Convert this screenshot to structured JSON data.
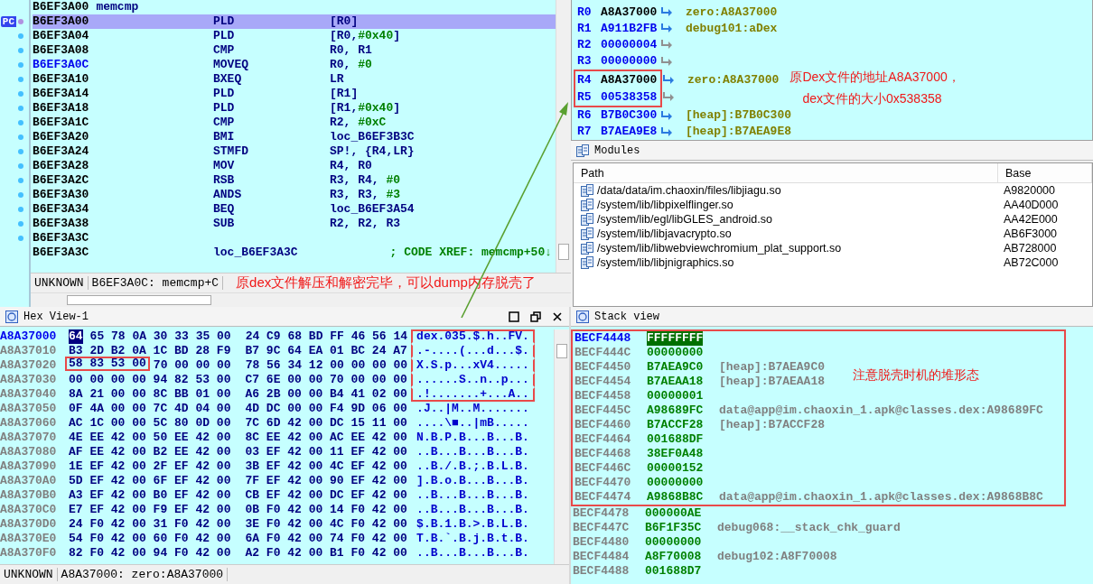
{
  "disassembly": {
    "function_header": {
      "address": "B6EF3A00",
      "name": "memcmp"
    },
    "pc_marker": "PC",
    "lines": [
      {
        "address": "B6EF3A00",
        "mnemonic": "PLD",
        "operands": "[R0]",
        "selected": true,
        "cursor": false
      },
      {
        "address": "B6EF3A04",
        "mnemonic": "PLD",
        "operands": "[R0,#0x40]",
        "selected": false,
        "cursor": false
      },
      {
        "address": "B6EF3A08",
        "mnemonic": "CMP",
        "operands": "R0, R1",
        "selected": false,
        "cursor": false
      },
      {
        "address": "B6EF3A0C",
        "mnemonic": "MOVEQ",
        "operands": "R0, #0",
        "selected": false,
        "cursor": true
      },
      {
        "address": "B6EF3A10",
        "mnemonic": "BXEQ",
        "operands": "LR",
        "selected": false,
        "cursor": false
      },
      {
        "address": "B6EF3A14",
        "mnemonic": "PLD",
        "operands": "[R1]",
        "selected": false,
        "cursor": false
      },
      {
        "address": "B6EF3A18",
        "mnemonic": "PLD",
        "operands": "[R1,#0x40]",
        "selected": false,
        "cursor": false
      },
      {
        "address": "B6EF3A1C",
        "mnemonic": "CMP",
        "operands": "R2, #0xC",
        "selected": false,
        "cursor": false
      },
      {
        "address": "B6EF3A20",
        "mnemonic": "BMI",
        "operands": "loc_B6EF3B3C",
        "selected": false,
        "cursor": false
      },
      {
        "address": "B6EF3A24",
        "mnemonic": "STMFD",
        "operands": "SP!, {R4,LR}",
        "selected": false,
        "cursor": false
      },
      {
        "address": "B6EF3A28",
        "mnemonic": "MOV",
        "operands": "R4, R0",
        "selected": false,
        "cursor": false
      },
      {
        "address": "B6EF3A2C",
        "mnemonic": "RSB",
        "operands": "R3, R4, #0",
        "selected": false,
        "cursor": false
      },
      {
        "address": "B6EF3A30",
        "mnemonic": "ANDS",
        "operands": "R3, R3, #3",
        "selected": false,
        "cursor": false
      },
      {
        "address": "B6EF3A34",
        "mnemonic": "BEQ",
        "operands": "loc_B6EF3A54",
        "selected": false,
        "cursor": false
      },
      {
        "address": "B6EF3A38",
        "mnemonic": "SUB",
        "operands": "R2, R2, R3",
        "selected": false,
        "cursor": false
      },
      {
        "address": "B6EF3A3C",
        "selected": false,
        "cursor": false
      }
    ],
    "label_line": {
      "address": "B6EF3A3C",
      "label": "loc_B6EF3A3C",
      "comment": "; CODE XREF: memcmp+50↓"
    },
    "status": {
      "segment": "UNKNOWN",
      "location": "B6EF3A0C: memcmp+C",
      "note": "原dex文件解压和解密完毕，可以dump内存脱壳了"
    }
  },
  "registers": {
    "callout": [
      "原Dex文件的地址A8A37000，",
      "dex文件的大小0x538358"
    ],
    "rows": [
      {
        "name": "R0",
        "value": "A8A37000",
        "changed": true,
        "ref": "zero:A8A37000",
        "boxed": false
      },
      {
        "name": "R1",
        "value": "A911B2FB",
        "changed": false,
        "ref": "debug101:aDex",
        "boxed": false
      },
      {
        "name": "R2",
        "value": "00000004",
        "changed": false,
        "boxed": false
      },
      {
        "name": "R3",
        "value": "00000000",
        "changed": false,
        "boxed": false
      },
      {
        "name": "R4",
        "value": "A8A37000",
        "changed": true,
        "ref": "zero:A8A37000",
        "boxed": true
      },
      {
        "name": "R5",
        "value": "00538358",
        "changed": false,
        "boxed": true
      },
      {
        "name": "R6",
        "value": "B7B0C300",
        "changed": false,
        "ref": "[heap]:B7B0C300",
        "boxed": false
      },
      {
        "name": "R7",
        "value": "B7AEA9E8",
        "changed": false,
        "ref": "[heap]:B7AEA9E8",
        "boxed": false
      }
    ]
  },
  "modules": {
    "title": "Modules",
    "columns": [
      "Path",
      "Base"
    ],
    "rows": [
      {
        "path": "/data/data/im.chaoxin/files/libjiagu.so",
        "base": "A9820000"
      },
      {
        "path": "/system/lib/libpixelflinger.so",
        "base": "AA40D000"
      },
      {
        "path": "/system/lib/egl/libGLES_android.so",
        "base": "AA42E000"
      },
      {
        "path": "/system/lib/libjavacrypto.so",
        "base": "AB6F3000"
      },
      {
        "path": "/system/lib/libwebviewchromium_plat_support.so",
        "base": "AB728000"
      },
      {
        "path": "/system/lib/libjnigraphics.so",
        "base": "AB72C000"
      }
    ]
  },
  "hex_view": {
    "title": "Hex View-1",
    "rows": [
      {
        "address": "A8A37000",
        "cursor_byte": "64",
        "bytes": [
          "65 78 0A 30 33 35 00",
          "24 C9 68 BD FF 46 56 14"
        ],
        "ascii": "dex.035.$.h..FV.",
        "ascii_boxed": true
      },
      {
        "address": "A8A37010",
        "bytes": [
          "B3 2D B2 0A 1C BD 28 F9",
          "B7 9C 64 EA 01 BC 24 A7"
        ],
        "ascii": ".-....(...d...$.",
        "ascii_boxed": true
      },
      {
        "address": "A8A37020",
        "marked": "58 83 53 00",
        "bytes": [
          "70 00 00 00",
          "78 56 34 12 00 00 00 00"
        ],
        "ascii": "X.S.p...xV4.....",
        "ascii_boxed": true
      },
      {
        "address": "A8A37030",
        "bytes": [
          "00 00 00 00 94 82 53 00",
          "C7 6E 00 00 70 00 00 00"
        ],
        "ascii": "......S..n..p...",
        "ascii_boxed": true
      },
      {
        "address": "A8A37040",
        "bytes": [
          "8A 21 00 00 8C BB 01 00",
          "A6 2B 00 00 B4 41 02 00"
        ],
        "ascii": ".!.......+...A..",
        "ascii_boxed": true
      },
      {
        "address": "A8A37050",
        "bytes": [
          "0F 4A 00 00 7C 4D 04 00",
          "4D DC 00 00 F4 9D 06 00"
        ],
        "ascii": ".J..|M..M.......",
        "ascii_boxed": false
      },
      {
        "address": "A8A37060",
        "bytes": [
          "AC 1C 00 00 5C 80 0D 00",
          "7C 6D 42 00 DC 15 11 00"
        ],
        "ascii": "....\\■..|mB.....",
        "ascii_boxed": false
      },
      {
        "address": "A8A37070",
        "bytes": [
          "4E EE 42 00 50 EE 42 00",
          "8C EE 42 00 AC EE 42 00"
        ],
        "ascii": "N.B.P.B...B...B.",
        "ascii_boxed": false
      },
      {
        "address": "A8A37080",
        "bytes": [
          "AF EE 42 00 B2 EE 42 00",
          "03 EF 42 00 11 EF 42 00"
        ],
        "ascii": "..B...B...B...B.",
        "ascii_boxed": false
      },
      {
        "address": "A8A37090",
        "bytes": [
          "1E EF 42 00 2F EF 42 00",
          "3B EF 42 00 4C EF 42 00"
        ],
        "ascii": "..B./.B.;.B.L.B.",
        "ascii_boxed": false
      },
      {
        "address": "A8A370A0",
        "bytes": [
          "5D EF 42 00 6F EF 42 00",
          "7F EF 42 00 90 EF 42 00"
        ],
        "ascii": "].B.o.B...B...B.",
        "ascii_boxed": false
      },
      {
        "address": "A8A370B0",
        "bytes": [
          "A3 EF 42 00 B0 EF 42 00",
          "CB EF 42 00 DC EF 42 00"
        ],
        "ascii": "..B...B...B...B.",
        "ascii_boxed": false
      },
      {
        "address": "A8A370C0",
        "bytes": [
          "E7 EF 42 00 F9 EF 42 00",
          "0B F0 42 00 14 F0 42 00"
        ],
        "ascii": "..B...B...B...B.",
        "ascii_boxed": false
      },
      {
        "address": "A8A370D0",
        "bytes": [
          "24 F0 42 00 31 F0 42 00",
          "3E F0 42 00 4C F0 42 00"
        ],
        "ascii": "$.B.1.B.>.B.L.B.",
        "ascii_boxed": false
      },
      {
        "address": "A8A370E0",
        "bytes": [
          "54 F0 42 00 60 F0 42 00",
          "6A F0 42 00 74 F0 42 00"
        ],
        "ascii": "T.B.`.B.j.B.t.B.",
        "ascii_boxed": false
      },
      {
        "address": "A8A370F0",
        "bytes": [
          "82 F0 42 00 94 F0 42 00",
          "A2 F0 42 00 B1 F0 42 00"
        ],
        "ascii": "..B...B...B...B.",
        "ascii_boxed": false
      }
    ],
    "status": {
      "segment": "UNKNOWN",
      "location": "A8A37000: zero:A8A37000"
    }
  },
  "stack_view": {
    "title": "Stack view",
    "callout": "注意脱壳时机的堆形态",
    "rows": [
      {
        "address": "BECF4448",
        "value": "FFFFFFFF",
        "boxed": true,
        "cursor": true
      },
      {
        "address": "BECF444C",
        "value": "00000000",
        "boxed": true,
        "cursor": false
      },
      {
        "address": "BECF4450",
        "value": "B7AEA9C0",
        "ref": "[heap]:B7AEA9C0",
        "boxed": true,
        "cursor": false
      },
      {
        "address": "BECF4454",
        "value": "B7AEAA18",
        "ref": "[heap]:B7AEAA18",
        "boxed": true,
        "cursor": false
      },
      {
        "address": "BECF4458",
        "value": "00000001",
        "boxed": true,
        "cursor": false
      },
      {
        "address": "BECF445C",
        "value": "A98689FC",
        "ref": "data@app@im.chaoxin_1.apk@classes.dex:A98689FC",
        "boxed": true,
        "cursor": false
      },
      {
        "address": "BECF4460",
        "value": "B7ACCF28",
        "ref": "[heap]:B7ACCF28",
        "boxed": true,
        "cursor": false
      },
      {
        "address": "BECF4464",
        "value": "001688DF",
        "boxed": true,
        "cursor": false
      },
      {
        "address": "BECF4468",
        "value": "38EF0A48",
        "boxed": true,
        "cursor": false
      },
      {
        "address": "BECF446C",
        "value": "00000152",
        "boxed": true,
        "cursor": false
      },
      {
        "address": "BECF4470",
        "value": "00000000",
        "boxed": true,
        "cursor": false
      },
      {
        "address": "BECF4474",
        "value": "A9868B8C",
        "ref": "data@app@im.chaoxin_1.apk@classes.dex:A9868B8C",
        "boxed": true,
        "cursor": false
      },
      {
        "address": "BECF4478",
        "value": "000000AE",
        "boxed": false,
        "cursor": false
      },
      {
        "address": "BECF447C",
        "value": "B6F1F35C",
        "ref": "debug068:__stack_chk_guard",
        "boxed": false,
        "cursor": false
      },
      {
        "address": "BECF4480",
        "value": "00000000",
        "boxed": false,
        "cursor": false
      },
      {
        "address": "BECF4484",
        "value": "A8F70008",
        "ref": "debug102:A8F70008",
        "boxed": false,
        "cursor": false
      },
      {
        "address": "BECF4488",
        "value": "001688D7",
        "boxed": false,
        "cursor": false
      }
    ]
  }
}
